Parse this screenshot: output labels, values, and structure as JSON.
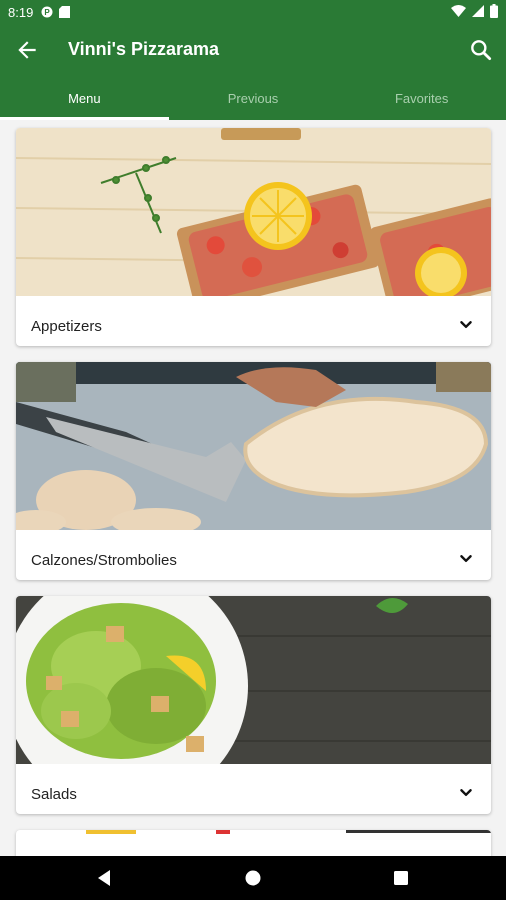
{
  "status_bar": {
    "time": "8:19"
  },
  "app_bar": {
    "title": "Vinni's Pizzarama"
  },
  "tabs": [
    {
      "label": "Menu",
      "active": true
    },
    {
      "label": "Previous",
      "active": false
    },
    {
      "label": "Favorites",
      "active": false
    }
  ],
  "menu_categories": [
    {
      "label": "Appetizers",
      "image": "bruschetta-photo"
    },
    {
      "label": "Calzones/Strombolies",
      "image": "calzone-photo"
    },
    {
      "label": "Salads",
      "image": "caesar-salad-photo"
    }
  ],
  "colors": {
    "primary": "#2a7a35",
    "tab_inactive": "#a9cfae",
    "background": "#f3f3f3"
  },
  "icons": [
    "back-arrow-icon",
    "search-icon",
    "chevron-down-icon",
    "nav-back-icon",
    "nav-home-icon",
    "nav-recents-icon"
  ]
}
